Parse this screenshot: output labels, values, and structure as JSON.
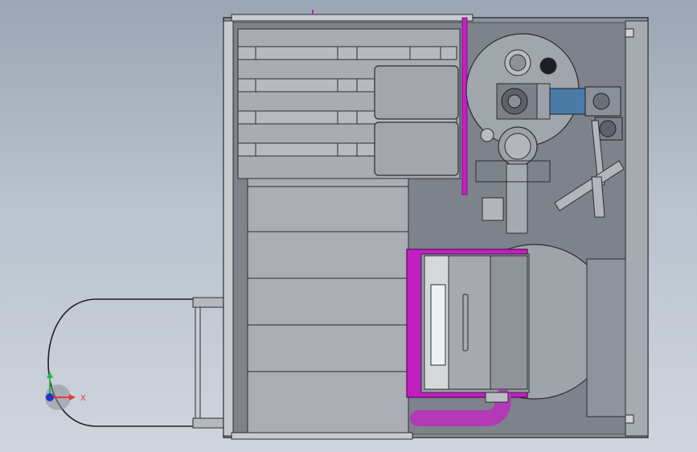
{
  "viewport": {
    "background_top": "#9aa6b4",
    "background_bottom": "#cfd5dc"
  },
  "colors": {
    "frame": "#8a8f98",
    "panel": "#a9acb3",
    "panel_dark": "#7c8089",
    "line": "#2b2e33",
    "accent_magenta": "#c81ec8",
    "pipe_magenta": "#b23ab7",
    "motor_blue": "#4a7aa6",
    "tank_fill": "#9fa3aa"
  },
  "triad": {
    "x_label": "X",
    "x_color": "#e23b3b",
    "y_color": "#2db34a",
    "origin_color": "#2238c9"
  }
}
